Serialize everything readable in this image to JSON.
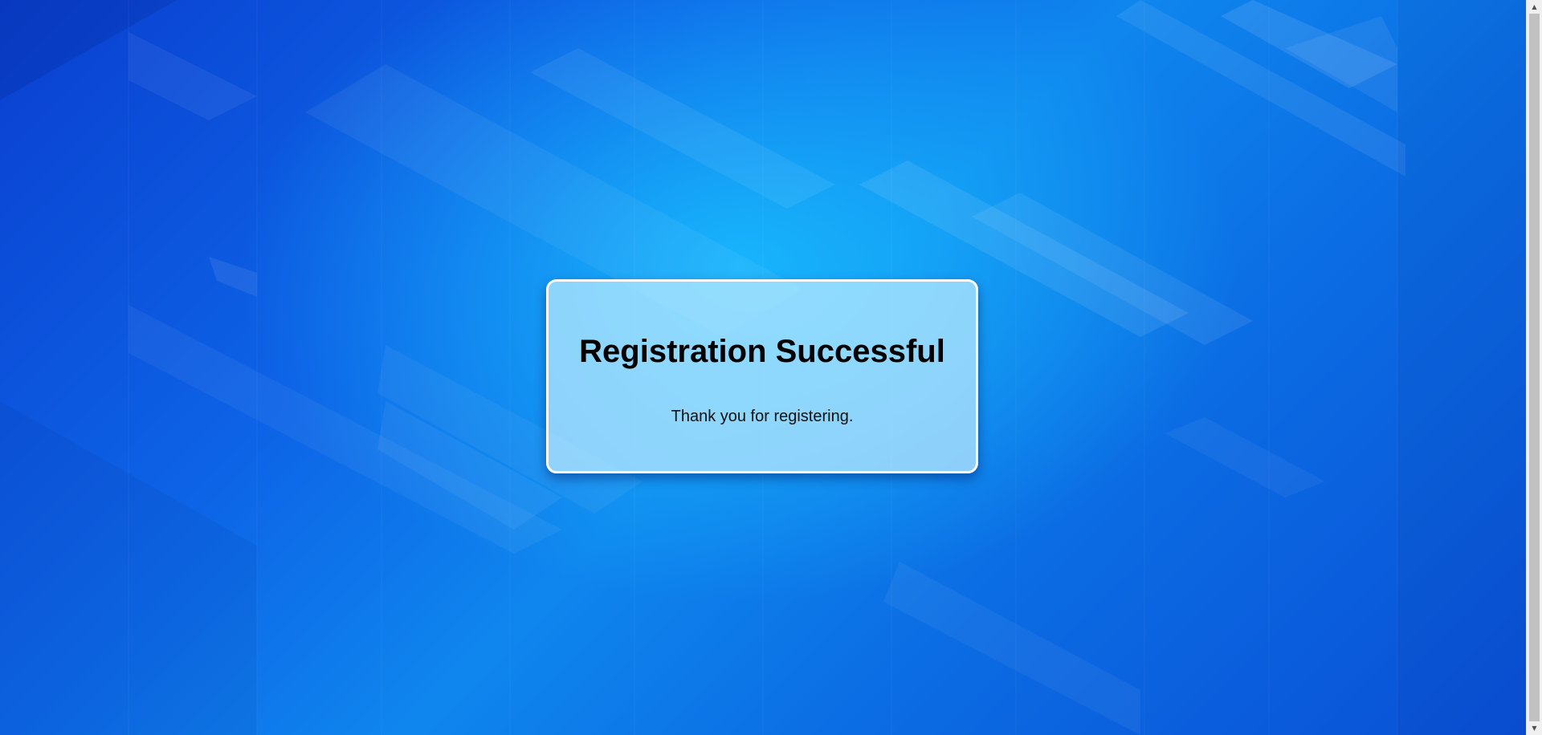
{
  "page": {
    "background_colors": [
      "#0a3fcf",
      "#0d63e6",
      "#0f86ee",
      "#19beff"
    ]
  },
  "dialog": {
    "title": "Registration Successful",
    "message": "Thank you for registering."
  },
  "scrollbar": {
    "up_icon": "scroll-up-arrow-icon",
    "down_icon": "scroll-down-arrow-icon"
  }
}
